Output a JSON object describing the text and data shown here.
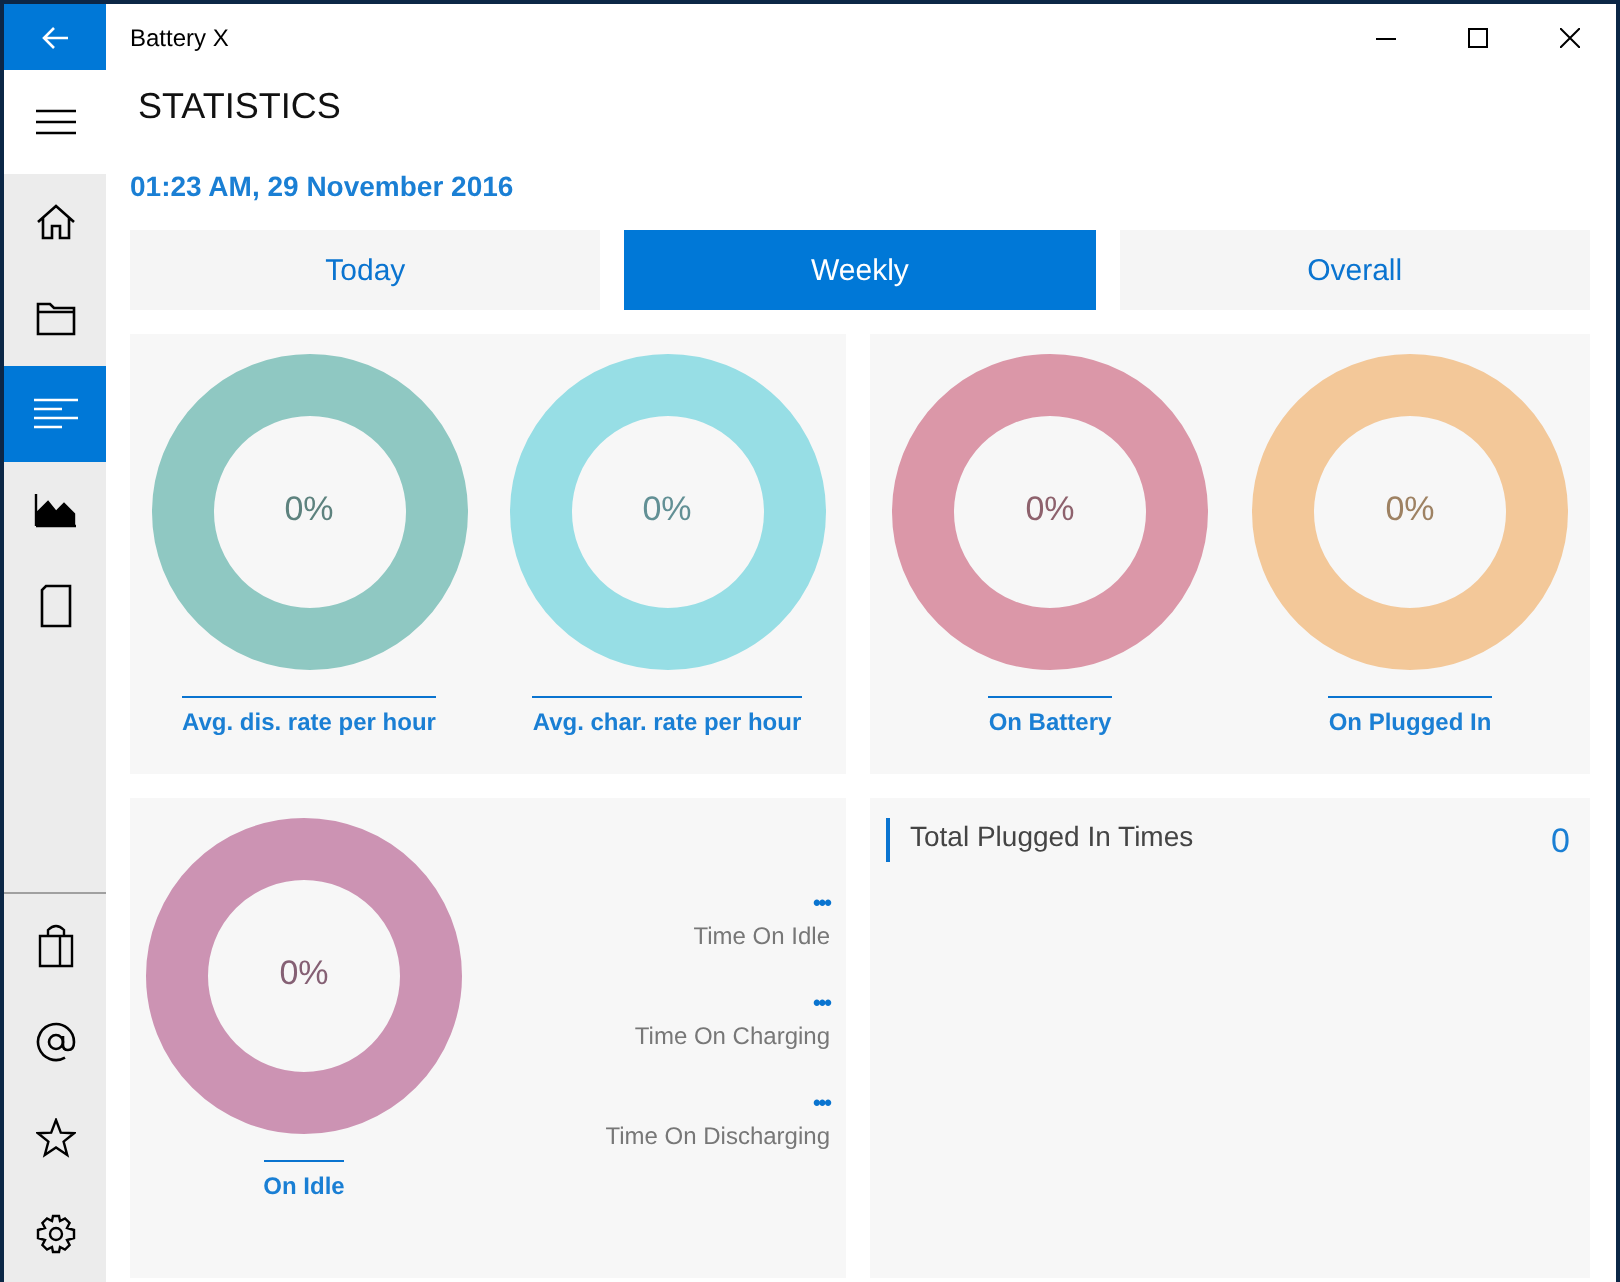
{
  "window": {
    "title": "Battery X"
  },
  "page": {
    "title": "STATISTICS",
    "date": "01:23 AM, 29 November 2016"
  },
  "tabs": [
    {
      "label": "Today",
      "selected": false
    },
    {
      "label": "Weekly",
      "selected": true
    },
    {
      "label": "Overall",
      "selected": false
    }
  ],
  "sidebar": {
    "items": [
      {
        "kind": "home",
        "selected": false
      },
      {
        "kind": "folder",
        "selected": false
      },
      {
        "kind": "list",
        "selected": true
      },
      {
        "kind": "chart",
        "selected": false
      },
      {
        "kind": "tablet",
        "selected": false
      }
    ],
    "footer_items": [
      {
        "kind": "bag"
      },
      {
        "kind": "at"
      },
      {
        "kind": "star"
      },
      {
        "kind": "gear"
      }
    ]
  },
  "rate_cards": [
    {
      "rings": [
        {
          "value": "0%",
          "label": "Avg. dis. rate per hour",
          "color": "#8fc8c2"
        },
        {
          "value": "0%",
          "label": "Avg. char. rate per hour",
          "color": "#97dee5"
        }
      ]
    },
    {
      "rings": [
        {
          "value": "0%",
          "label": "On Battery",
          "color": "#db97a8"
        },
        {
          "value": "0%",
          "label": "On Plugged In",
          "color": "#f3c899"
        }
      ]
    }
  ],
  "idle_card": {
    "ring": {
      "value": "0%",
      "label": "On Idle",
      "color": "#cc93b3"
    },
    "stats": [
      {
        "value": "•••",
        "label": "Time On Idle"
      },
      {
        "value": "•••",
        "label": "Time On Charging"
      },
      {
        "value": "•••",
        "label": "Time On Discharging"
      }
    ]
  },
  "plugged_card": {
    "label": "Total Plugged In Times",
    "value": "0"
  }
}
